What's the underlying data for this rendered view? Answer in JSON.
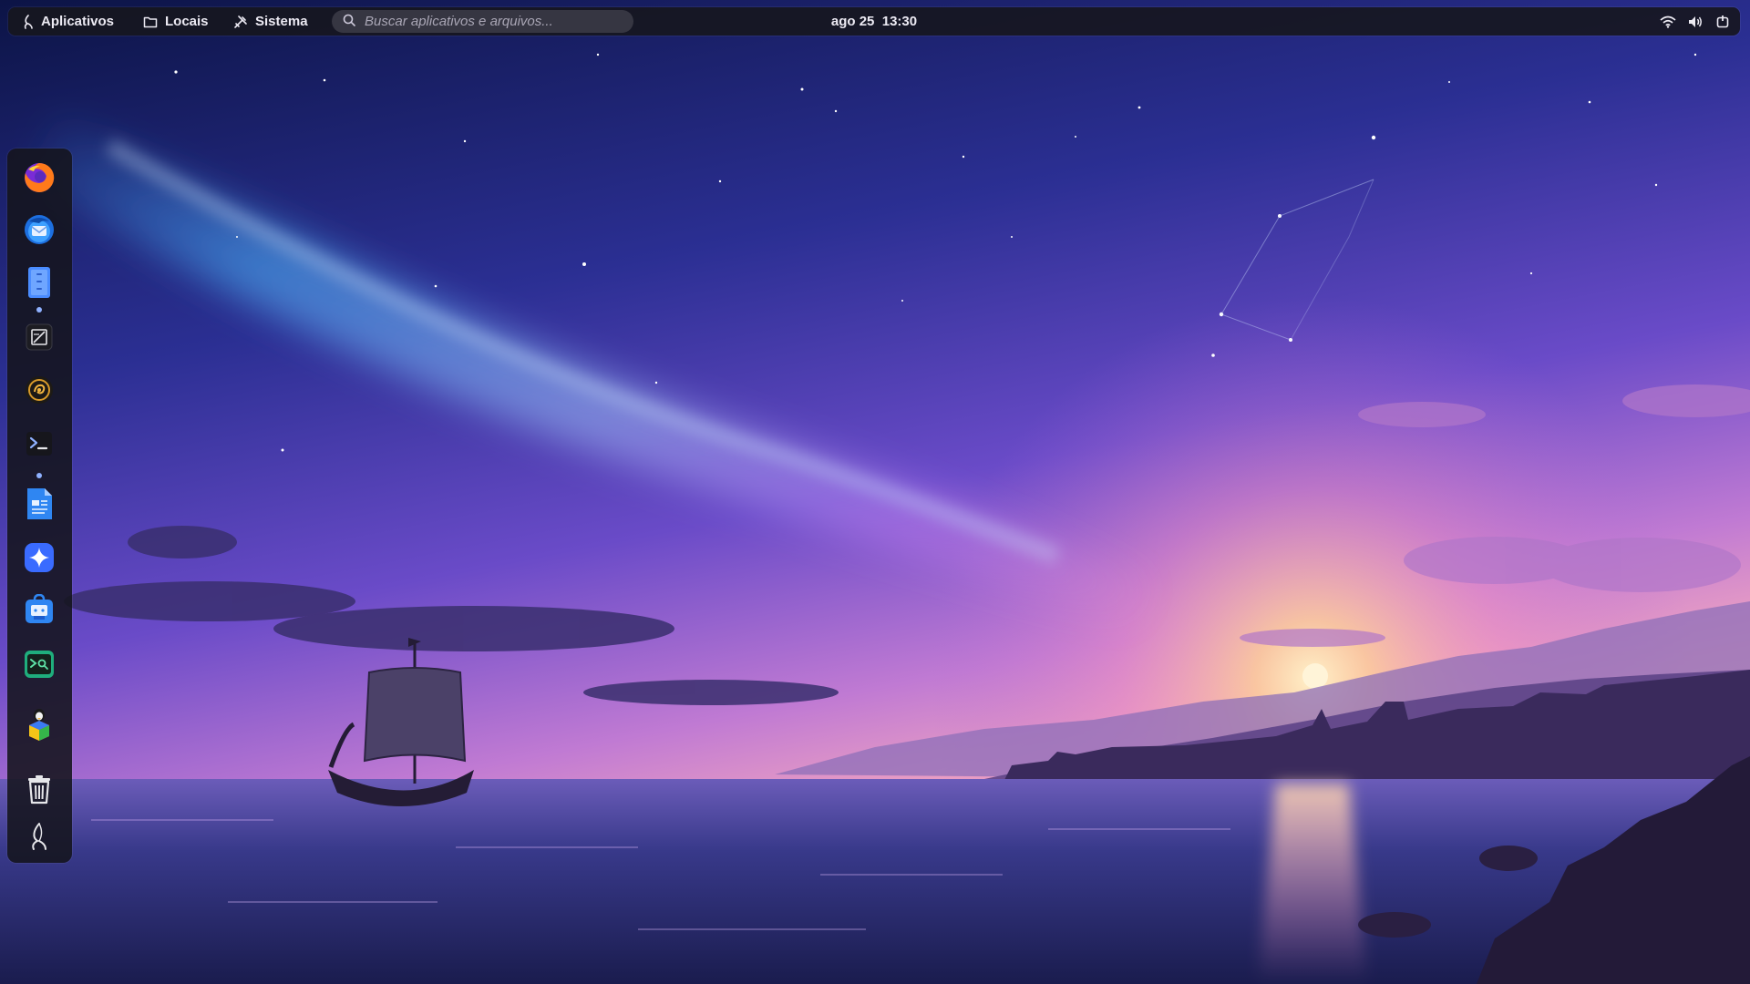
{
  "top_panel": {
    "apps_label": "Aplicativos",
    "places_label": "Locais",
    "system_label": "Sistema",
    "search_placeholder": "Buscar aplicativos e arquivos...",
    "clock_date": "ago 25",
    "clock_time": "13:30",
    "tray_icons": [
      "wifi-icon",
      "volume-icon",
      "power-icon"
    ]
  },
  "dock": {
    "items": [
      {
        "name": "firefox",
        "icon": "firefox-icon",
        "running": false
      },
      {
        "name": "thunderbird",
        "icon": "thunderbird-icon",
        "running": false
      },
      {
        "name": "files",
        "icon": "files-icon",
        "running": true
      },
      {
        "name": "text-editor",
        "icon": "text-editor-icon",
        "running": false
      },
      {
        "name": "music-player",
        "icon": "music-player-icon",
        "running": false
      },
      {
        "name": "terminal",
        "icon": "terminal-icon",
        "running": true
      },
      {
        "name": "document-writer",
        "icon": "document-icon",
        "running": false
      },
      {
        "name": "assistant",
        "icon": "sparkle-icon",
        "running": false
      },
      {
        "name": "software-store",
        "icon": "store-icon",
        "running": false
      },
      {
        "name": "system-monitor",
        "icon": "monitor-terminal-icon",
        "running": false
      },
      {
        "name": "package-manager",
        "icon": "package-icon",
        "running": false
      },
      {
        "name": "trash",
        "icon": "trash-icon",
        "running": false
      },
      {
        "name": "distro-menu",
        "icon": "distro-logo-icon",
        "running": false
      }
    ]
  },
  "colors": {
    "panel_bg": "#16161e",
    "accent": "#8fb1ff",
    "sky_top": "#101a55",
    "sky_mid": "#5a3fbf",
    "horizon": "#f3a3c8",
    "sea": "#2b2c6e"
  }
}
